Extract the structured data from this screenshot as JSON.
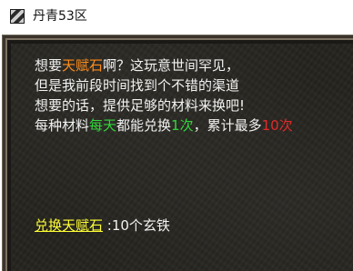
{
  "window": {
    "title": "丹青53区",
    "icon": "game-app-icon"
  },
  "dialog": {
    "line1": {
      "pre": "想要",
      "highlight": "天赋石",
      "post": "啊？这玩意世间罕见，"
    },
    "line2": "但是我前段时间找到个不错的渠道",
    "line3": "想要的话，提供足够的材料来换吧!",
    "line4": {
      "pre": "每种材料",
      "daily": "每天",
      "mid": "都能兑换",
      "count": "1次",
      "sep": "，累计最多",
      "total": "10次"
    }
  },
  "exchange": {
    "link_label": "兑换天赋石",
    "cost": " :10个玄铁"
  },
  "colors": {
    "highlight_orange": "#ff8c1a",
    "highlight_green": "#33d63a",
    "highlight_red": "#e12a2a",
    "link_yellow": "#ffff33",
    "text": "#f2f2f2"
  }
}
